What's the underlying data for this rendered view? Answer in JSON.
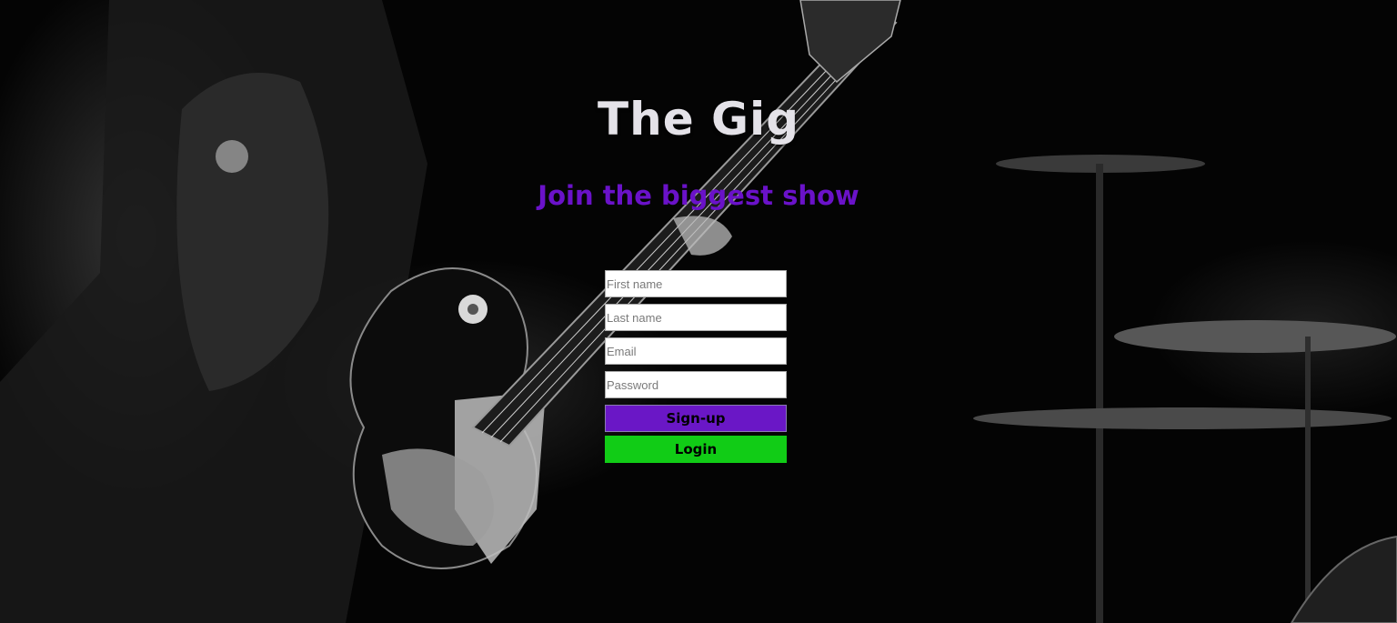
{
  "header": {
    "title": "The Gig",
    "tagline": "Join the biggest show"
  },
  "form": {
    "first_name_placeholder": "First name",
    "last_name_placeholder": "Last name",
    "email_placeholder": "Email",
    "password_placeholder": "Password",
    "signup_label": "Sign-up",
    "login_label": "Login"
  },
  "colors": {
    "title": "#e4e2e8",
    "tagline": "#6a12c9",
    "signup_button": "#6a17c6",
    "login_button": "#11cc16"
  }
}
